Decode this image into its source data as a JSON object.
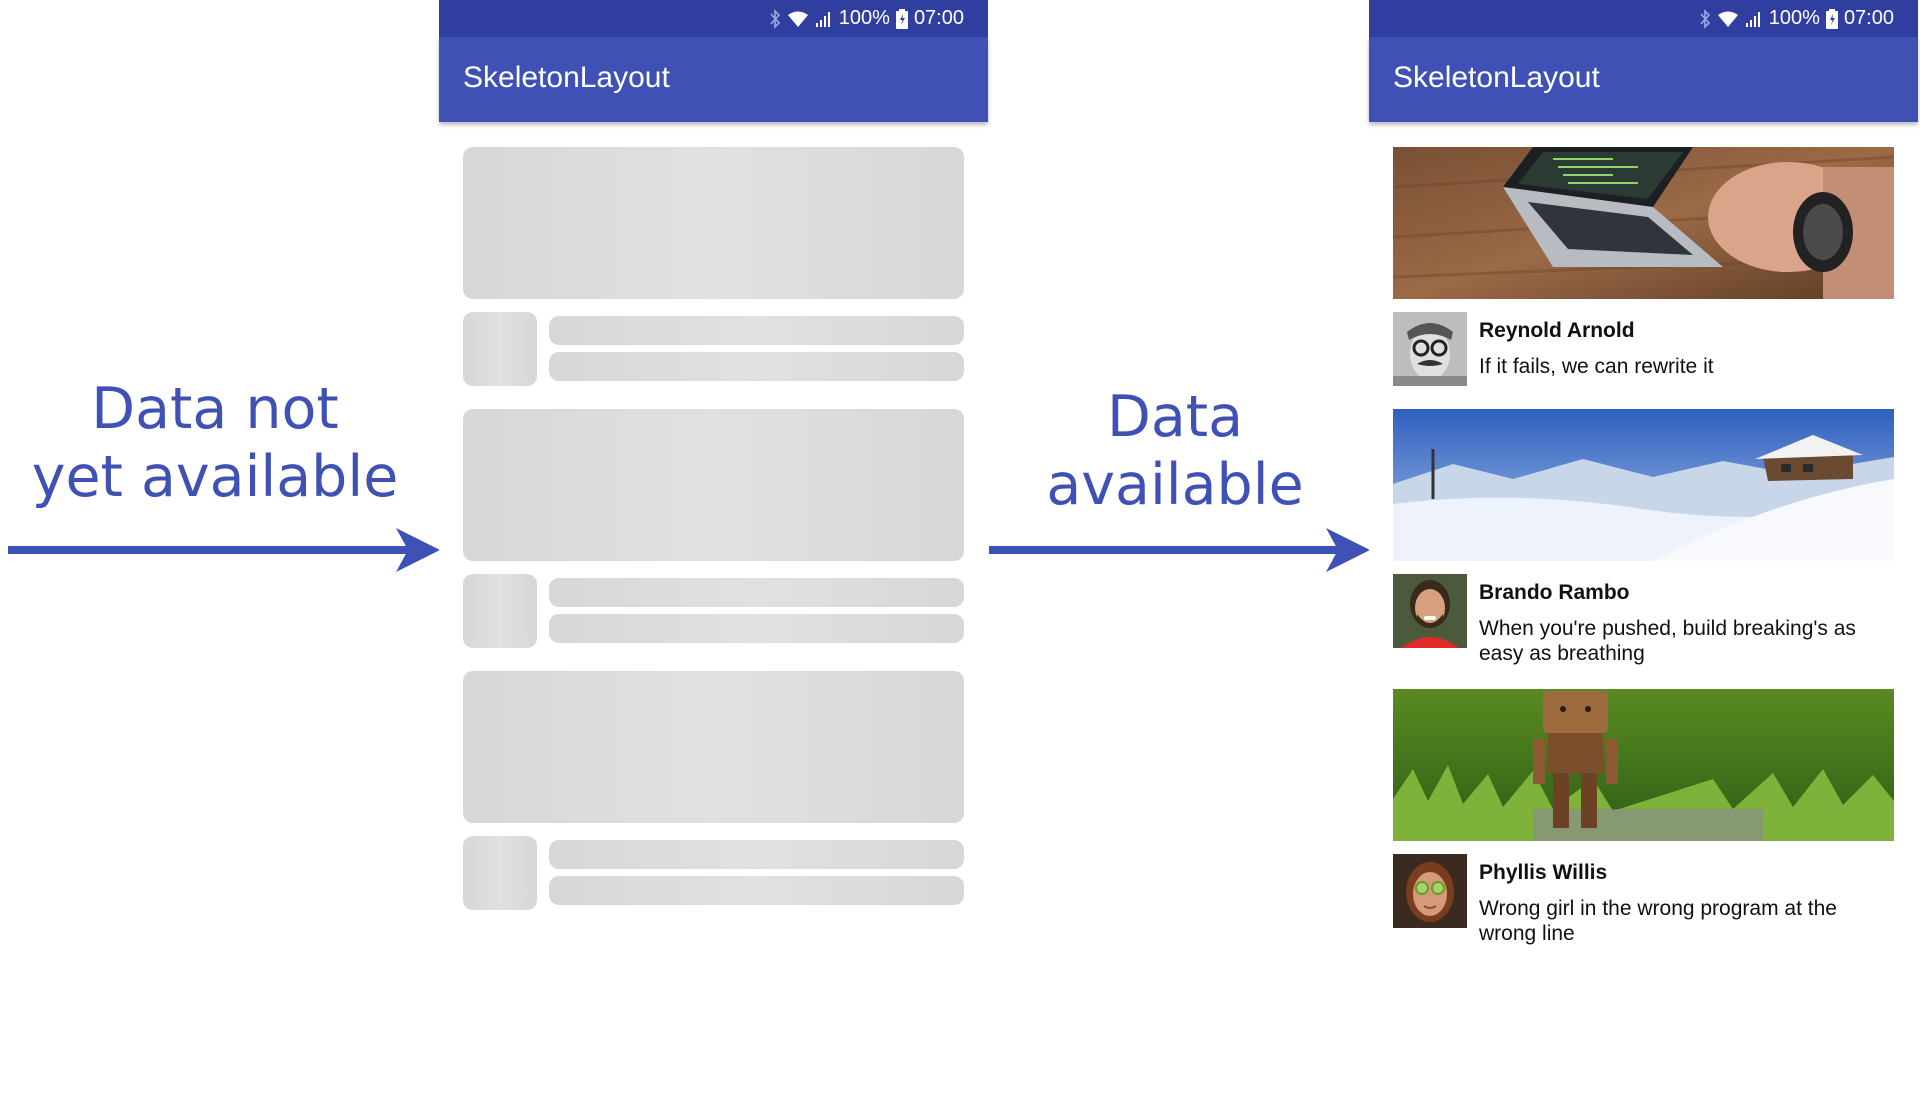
{
  "labels": {
    "left_caption": [
      "Data not",
      "yet available"
    ],
    "right_caption": [
      "Data",
      "available"
    ]
  },
  "colors": {
    "accent": "#3F51B5",
    "status_bar": "#303F9F",
    "skeleton": "#DCDCDC"
  },
  "phone": {
    "status": {
      "battery_text": "100%",
      "time": "07:00",
      "icons": [
        "bluetooth-icon",
        "wifi-icon",
        "signal-icon",
        "battery-icon"
      ]
    },
    "app_title": "SkeletonLayout"
  },
  "skeleton_count": 3,
  "feed": [
    {
      "name": "Reynold Arnold",
      "quote": "If it fails, we can rewrite it",
      "photo": "laptop-typing",
      "avatar": "glasses-mustache-man"
    },
    {
      "name": "Brando Rambo",
      "quote": "When you're pushed, build breaking's as easy as breathing",
      "photo": "snowy-mountain-hut",
      "avatar": "smiling-bearded-man"
    },
    {
      "name": "Phyllis Willis",
      "quote": "Wrong girl in the wrong program at the wrong line",
      "photo": "wooden-robot-grass",
      "avatar": "woman-cucumber-mask"
    }
  ]
}
